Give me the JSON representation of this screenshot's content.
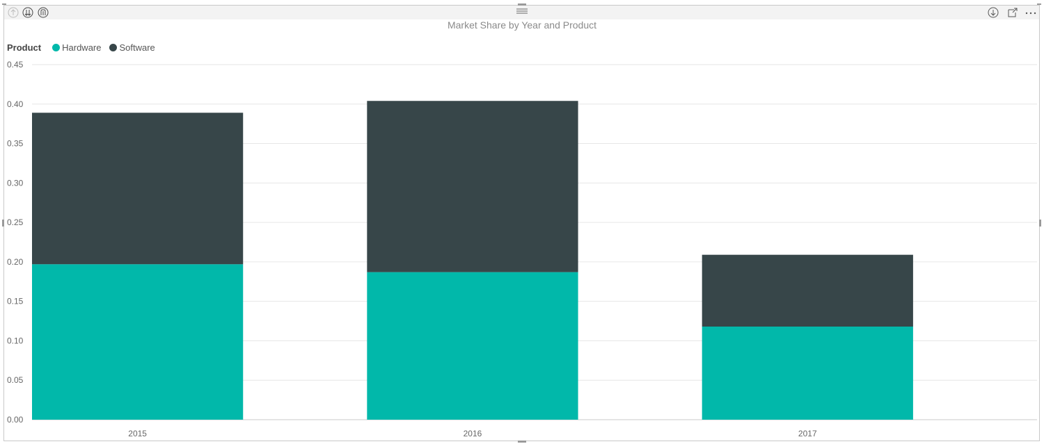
{
  "toolbar": {
    "icons": [
      "drill-up-icon",
      "expand-all-down-icon",
      "drill-down-icon",
      "move-handle-icon",
      "drill-mode-icon",
      "focus-mode-icon",
      "more-options-icon"
    ]
  },
  "chart_data": {
    "type": "bar",
    "stacked": true,
    "title": "Market Share by Year and Product",
    "legend_title": "Product",
    "legend_position": "top-left",
    "categories": [
      "2015",
      "2016",
      "2017"
    ],
    "series": [
      {
        "name": "Hardware",
        "color": "#01B8AA",
        "values": [
          0.197,
          0.187,
          0.118
        ]
      },
      {
        "name": "Software",
        "color": "#374649",
        "values": [
          0.192,
          0.217,
          0.091
        ]
      }
    ],
    "xlabel": "",
    "ylabel": "",
    "ylim": [
      0,
      0.45
    ],
    "yticks": [
      "0.00",
      "0.05",
      "0.10",
      "0.15",
      "0.20",
      "0.25",
      "0.30",
      "0.35",
      "0.40",
      "0.45"
    ],
    "grid": true
  }
}
